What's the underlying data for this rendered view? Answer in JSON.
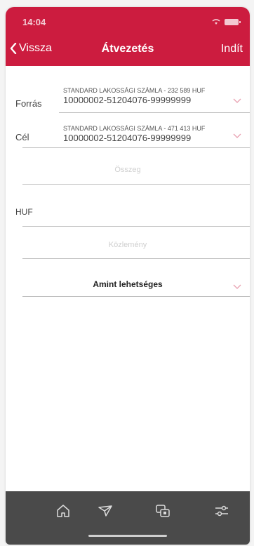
{
  "status_bar": {
    "time": "14:04"
  },
  "header": {
    "back_label": "Vissza",
    "title": "Átvezetés",
    "action_label": "Indít"
  },
  "form": {
    "source": {
      "label": "Forrás",
      "account_name": "STANDARD LAKOSSÁGI SZÁMLA - 232 589 HUF",
      "account_number": "10000002-51204076-99999999"
    },
    "target": {
      "label": "Cél",
      "account_name": "STANDARD LAKOSSÁGI SZÁMLA - 471 413 HUF",
      "account_number": "10000002-51204076-99999999"
    },
    "amount_placeholder": "Összeg",
    "currency": "HUF",
    "note_placeholder": "Közlemény",
    "timing_value": "Amint lehetséges"
  },
  "tabbar": {
    "items": [
      {
        "icon": "home-icon"
      },
      {
        "icon": "send-icon"
      },
      {
        "icon": "transfer-icon"
      },
      {
        "icon": "settings-sliders-icon"
      }
    ]
  },
  "colors": {
    "brand": "#cc1c3f",
    "tabbar": "#4a4a4a",
    "dropdown_arrow": "#e8a0b0"
  }
}
